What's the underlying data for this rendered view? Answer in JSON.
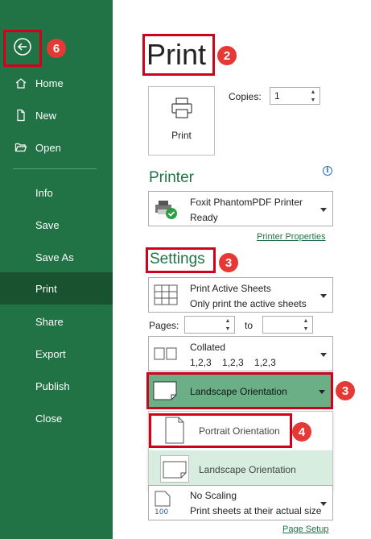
{
  "sidebar": {
    "back_icon": "back-arrow-icon",
    "items": [
      {
        "label": "Home",
        "icon": "home-icon"
      },
      {
        "label": "New",
        "icon": "new-document-icon"
      },
      {
        "label": "Open",
        "icon": "folder-open-icon"
      },
      {
        "label": "Info"
      },
      {
        "label": "Save"
      },
      {
        "label": "Save As"
      },
      {
        "label": "Print"
      },
      {
        "label": "Share"
      },
      {
        "label": "Export"
      },
      {
        "label": "Publish"
      },
      {
        "label": "Close"
      }
    ],
    "active": "Print",
    "colors": {
      "background": "#217346",
      "active": "#18522f"
    }
  },
  "callouts": [
    "6",
    "2",
    "3",
    "3",
    "4"
  ],
  "main": {
    "title": "Print",
    "print_button_label": "Print",
    "copies_label": "Copies:",
    "copies_value": "1",
    "printer": {
      "title": "Printer",
      "name": "Foxit PhantomPDF Printer",
      "status": "Ready",
      "properties_link": "Printer Properties"
    },
    "settings": {
      "title": "Settings",
      "print_what": {
        "line1": "Print Active Sheets",
        "line2": "Only print the active sheets"
      },
      "pages_label": "Pages:",
      "to_label": "to",
      "collation": {
        "line1": "Collated",
        "line2": "1,2,3    1,2,3    1,2,3"
      },
      "orientation_selected": "Landscape Orientation",
      "orientation_options": [
        "Portrait Orientation",
        "Landscape Orientation"
      ],
      "scaling": {
        "line1": "No Scaling",
        "line2": "Print sheets at their actual size",
        "icon_text": "100"
      },
      "page_setup_link": "Page Setup"
    }
  }
}
